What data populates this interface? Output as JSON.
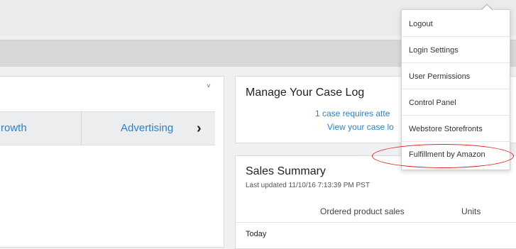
{
  "widget": {
    "tabs": [
      {
        "label": "rowth"
      },
      {
        "label": "Advertising"
      }
    ],
    "next_arrow": "›",
    "dropdown_caret": "˅"
  },
  "case_log": {
    "title": "Manage Your Case Log",
    "line1": "1 case requires atte",
    "line2": "View your case lo"
  },
  "sales_summary": {
    "title": "Sales Summary",
    "last_updated": "Last updated 11/10/16 7:13:39 PM PST",
    "columns": [
      "Ordered product sales",
      "Units"
    ],
    "rows": [
      "Today"
    ]
  },
  "account_menu": {
    "items": [
      "Logout",
      "Login Settings",
      "User Permissions",
      "Control Panel",
      "Webstore Storefronts",
      "Fulfillment by Amazon"
    ],
    "highlighted_item": "Fulfillment by Amazon",
    "highlight_color": "#e02020"
  },
  "colors": {
    "link": "#2f7fc4"
  }
}
